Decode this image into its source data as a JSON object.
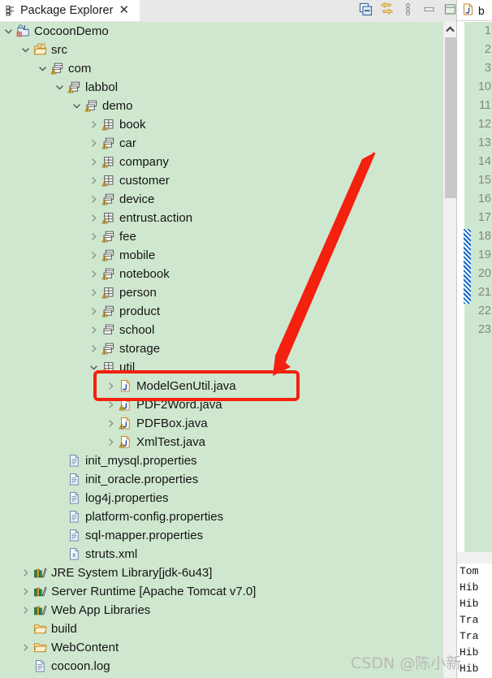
{
  "view": {
    "tab_label": "Package Explorer",
    "tab_icon": "package-explorer-icon",
    "close_icon": "close-icon",
    "toolbar": [
      {
        "name": "collapse-all-icon",
        "label": "Collapse All"
      },
      {
        "name": "link-with-editor-icon",
        "label": "Link with Editor"
      },
      {
        "name": "view-menu-icon",
        "label": "View Menu"
      },
      {
        "name": "minimize-icon",
        "label": "Minimize"
      },
      {
        "name": "maximize-icon",
        "label": "Maximize"
      }
    ]
  },
  "tree": {
    "rows": [
      {
        "indent": 0,
        "twisty": "expanded",
        "icon": "java-project-icon",
        "label": "CocoonDemo"
      },
      {
        "indent": 1,
        "twisty": "expanded",
        "icon": "source-folder-icon",
        "label": "src"
      },
      {
        "indent": 2,
        "twisty": "expanded",
        "icon": "package-icon",
        "label": "com"
      },
      {
        "indent": 3,
        "twisty": "expanded",
        "icon": "package-icon",
        "label": "labbol"
      },
      {
        "indent": 4,
        "twisty": "expanded",
        "icon": "package-icon",
        "label": "demo"
      },
      {
        "indent": 5,
        "twisty": "collapsed",
        "icon": "package-full-icon",
        "label": "book"
      },
      {
        "indent": 5,
        "twisty": "collapsed",
        "icon": "package-icon",
        "label": "car"
      },
      {
        "indent": 5,
        "twisty": "collapsed",
        "icon": "package-full-icon",
        "label": "company"
      },
      {
        "indent": 5,
        "twisty": "collapsed",
        "icon": "package-full-icon",
        "label": "customer"
      },
      {
        "indent": 5,
        "twisty": "collapsed",
        "icon": "package-icon",
        "label": "device"
      },
      {
        "indent": 5,
        "twisty": "collapsed",
        "icon": "package-full-icon",
        "label": "entrust.action"
      },
      {
        "indent": 5,
        "twisty": "collapsed",
        "icon": "package-icon",
        "label": "fee"
      },
      {
        "indent": 5,
        "twisty": "collapsed",
        "icon": "package-icon",
        "label": "mobile"
      },
      {
        "indent": 5,
        "twisty": "collapsed",
        "icon": "package-icon",
        "label": "notebook"
      },
      {
        "indent": 5,
        "twisty": "collapsed",
        "icon": "package-full-icon",
        "label": "person"
      },
      {
        "indent": 5,
        "twisty": "collapsed",
        "icon": "package-icon",
        "label": "product"
      },
      {
        "indent": 5,
        "twisty": "collapsed",
        "icon": "package-plain-icon",
        "label": "school"
      },
      {
        "indent": 5,
        "twisty": "collapsed",
        "icon": "package-icon",
        "label": "storage"
      },
      {
        "indent": 5,
        "twisty": "expanded",
        "icon": "package-full-icon",
        "label": "util"
      },
      {
        "indent": 6,
        "twisty": "collapsed",
        "icon": "java-file-icon",
        "label": "ModelGenUtil.java"
      },
      {
        "indent": 6,
        "twisty": "collapsed",
        "icon": "java-file-warn-icon",
        "label": "PDF2Word.java"
      },
      {
        "indent": 6,
        "twisty": "collapsed",
        "icon": "java-file-warn-icon",
        "label": "PDFBox.java"
      },
      {
        "indent": 6,
        "twisty": "collapsed",
        "icon": "java-file-warn-icon",
        "label": "XmlTest.java"
      },
      {
        "indent": 3,
        "twisty": "none",
        "icon": "properties-file-icon",
        "label": "init_mysql.properties"
      },
      {
        "indent": 3,
        "twisty": "none",
        "icon": "properties-file-icon",
        "label": "init_oracle.properties"
      },
      {
        "indent": 3,
        "twisty": "none",
        "icon": "properties-file-icon",
        "label": "log4j.properties"
      },
      {
        "indent": 3,
        "twisty": "none",
        "icon": "properties-file-icon",
        "label": "platform-config.properties"
      },
      {
        "indent": 3,
        "twisty": "none",
        "icon": "properties-file-icon",
        "label": "sql-mapper.properties"
      },
      {
        "indent": 3,
        "twisty": "none",
        "icon": "xml-file-icon",
        "label": "struts.xml"
      },
      {
        "indent": 1,
        "twisty": "collapsed",
        "icon": "library-icon",
        "label": "JRE System Library ",
        "dim": "[jdk-6u43]"
      },
      {
        "indent": 1,
        "twisty": "collapsed",
        "icon": "library-icon",
        "label": "Server Runtime [Apache Tomcat v7.0]"
      },
      {
        "indent": 1,
        "twisty": "collapsed",
        "icon": "library-icon",
        "label": "Web App Libraries"
      },
      {
        "indent": 1,
        "twisty": "none",
        "icon": "folder-icon",
        "label": "build"
      },
      {
        "indent": 1,
        "twisty": "collapsed",
        "icon": "folder-icon",
        "label": "WebContent"
      },
      {
        "indent": 1,
        "twisty": "none",
        "icon": "log-file-icon",
        "label": "cocoon.log"
      }
    ]
  },
  "annotation": {
    "color": "#f42010",
    "highlight_target": "ModelGenUtil.java",
    "shapes": [
      "red-rectangle",
      "red-arrow"
    ]
  },
  "editor": {
    "tab_icon": "java-file-icon",
    "tab_label": "b",
    "line_numbers": [
      "1",
      "2",
      "3",
      "10",
      "11",
      "12",
      "13",
      "14",
      "15",
      "16",
      "17",
      "18",
      "19",
      "20",
      "21",
      "22",
      "23"
    ],
    "selected_lines": [
      "18",
      "19",
      "20",
      "21"
    ]
  },
  "console": {
    "lines": [
      "Tom",
      "Hib",
      "Hib",
      "Tra",
      "Tra",
      "Hib",
      "Hib"
    ]
  },
  "watermark": {
    "text": "CSDN @陈小新"
  }
}
